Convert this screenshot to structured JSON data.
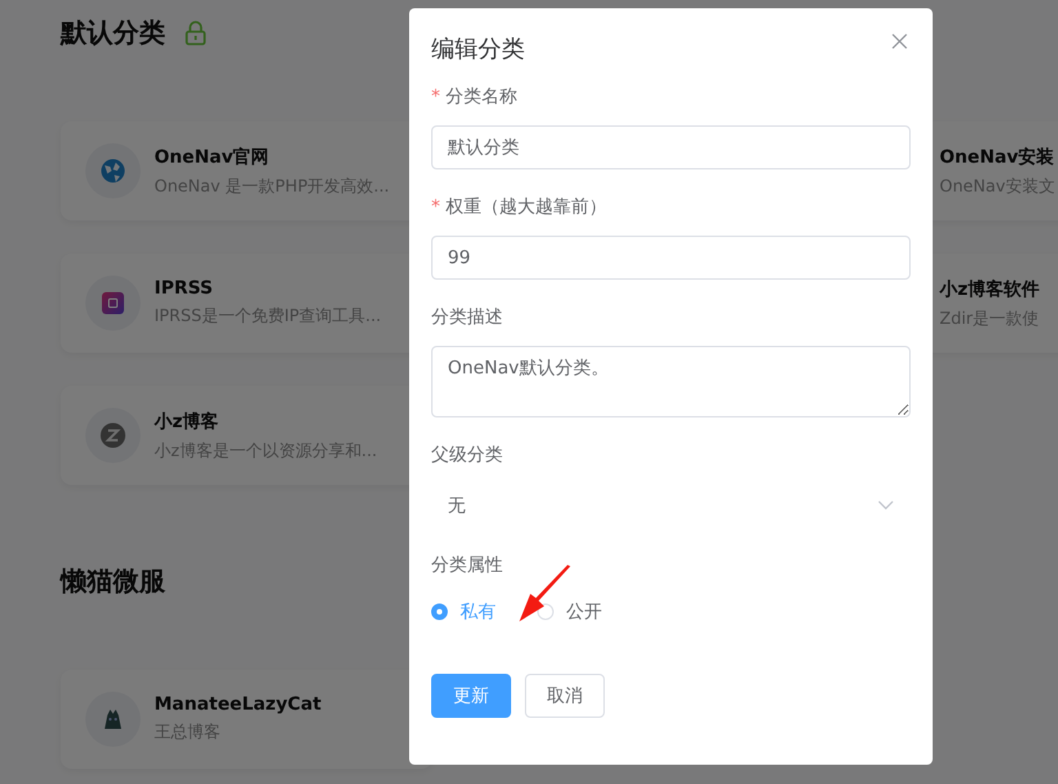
{
  "sections": [
    {
      "title": "默认分类",
      "rows": [
        {
          "left": {
            "title": "OneNav官网",
            "desc": "OneNav 是一款PHP开发高效..."
          },
          "right": {
            "title": "OneNav安装",
            "desc": "OneNav安装文"
          }
        },
        {
          "left": {
            "title": "IPRSS",
            "desc": "IPRSS是一个免费IP查询工具..."
          },
          "right": {
            "title": "小z博客软件",
            "desc": "Zdir是一款使"
          }
        },
        {
          "left": {
            "title": "小z博客",
            "desc": "小z博客是一个以资源分享和..."
          }
        }
      ]
    },
    {
      "title": "懒猫微服",
      "rows": [
        {
          "left": {
            "title": "ManateeLazyCat",
            "desc": "王总博客"
          }
        }
      ]
    }
  ],
  "dialog": {
    "title": "编辑分类",
    "fields": [
      {
        "kind": "input",
        "label": "分类名称",
        "required_mark": "*",
        "value": "默认分类"
      },
      {
        "kind": "input",
        "label": "权重（越大越靠前）",
        "required_mark": "*",
        "value": "99"
      },
      {
        "kind": "textarea",
        "label": "分类描述",
        "value": "OneNav默认分类。"
      },
      {
        "kind": "select",
        "label": "父级分类",
        "value": "无"
      },
      {
        "kind": "radio",
        "label": "分类属性",
        "options": [
          {
            "label": "私有",
            "selected": true
          },
          {
            "label": "公开",
            "selected": false
          }
        ]
      }
    ],
    "buttons": [
      {
        "label": "更新",
        "kind": "primary"
      },
      {
        "label": "取消",
        "kind": "default"
      }
    ]
  }
}
